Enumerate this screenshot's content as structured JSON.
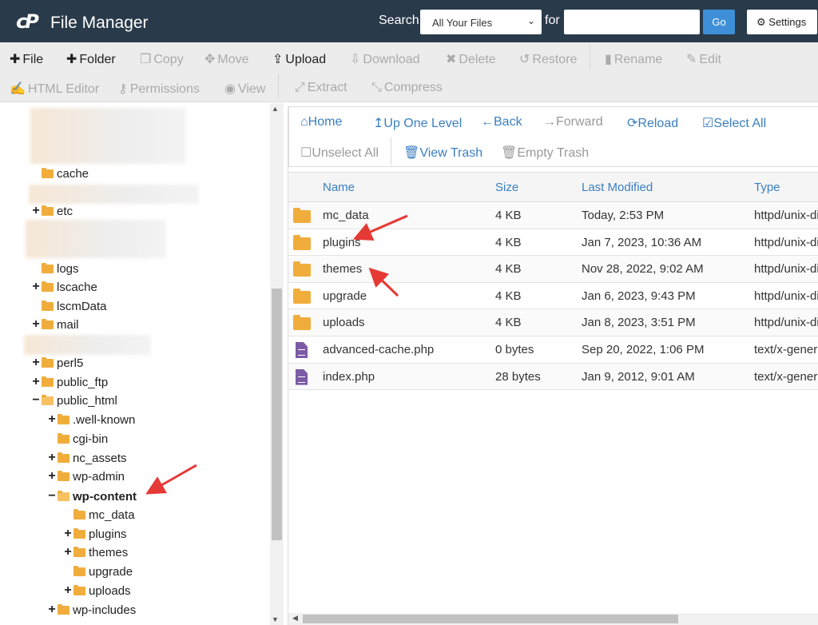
{
  "header": {
    "title": "File Manager",
    "search_label": "Search",
    "search_scope": "All Your Files",
    "for_label": "for",
    "search_value": "",
    "go": "Go",
    "settings": "Settings"
  },
  "toolbar": [
    {
      "label": "File",
      "icon": "plus",
      "enabled": true
    },
    {
      "label": "Folder",
      "icon": "plus",
      "enabled": true
    },
    {
      "label": "Copy",
      "icon": "copy",
      "enabled": false
    },
    {
      "label": "Move",
      "icon": "move",
      "enabled": false
    },
    {
      "label": "Upload",
      "icon": "upload",
      "enabled": true
    },
    {
      "label": "Download",
      "icon": "download",
      "enabled": false
    },
    {
      "label": "Delete",
      "icon": "x",
      "enabled": false
    },
    {
      "label": "Restore",
      "icon": "undo",
      "enabled": false
    },
    {
      "label": "Rename",
      "icon": "file",
      "enabled": false
    },
    {
      "label": "Edit",
      "icon": "pencil",
      "enabled": false
    },
    {
      "label": "HTML Editor",
      "icon": "edit",
      "enabled": false
    },
    {
      "label": "Permissions",
      "icon": "key",
      "enabled": false
    },
    {
      "label": "View",
      "icon": "eye",
      "enabled": false
    },
    {
      "label": "Extract",
      "icon": "expand",
      "enabled": false
    },
    {
      "label": "Compress",
      "icon": "compress",
      "enabled": false
    }
  ],
  "nav": [
    {
      "label": "Home",
      "icon": "home"
    },
    {
      "label": "Up One Level",
      "icon": "level-up"
    },
    {
      "label": "Back",
      "icon": "arrow-left"
    },
    {
      "label": "Forward",
      "icon": "arrow-right"
    },
    {
      "label": "Reload",
      "icon": "refresh"
    },
    {
      "label": "Select All",
      "icon": "check-square"
    },
    {
      "label": "Unselect All",
      "icon": "square"
    },
    {
      "label": "View Trash",
      "icon": "trash"
    },
    {
      "label": "Empty Trash",
      "icon": "trash"
    }
  ],
  "tree": [
    {
      "label": "cache",
      "exp": ""
    },
    {
      "label": "etc",
      "exp": "+"
    },
    {
      "label": "logs",
      "exp": ""
    },
    {
      "label": "lscache",
      "exp": "+"
    },
    {
      "label": "lscmData",
      "exp": ""
    },
    {
      "label": "mail",
      "exp": "+"
    },
    {
      "label": "perl5",
      "exp": "+"
    },
    {
      "label": "public_ftp",
      "exp": "+"
    },
    {
      "label": "public_html",
      "exp": "−"
    },
    {
      "label": ".well-known",
      "exp": "+"
    },
    {
      "label": "cgi-bin",
      "exp": ""
    },
    {
      "label": "nc_assets",
      "exp": "+"
    },
    {
      "label": "wp-admin",
      "exp": "+"
    },
    {
      "label": "wp-content",
      "exp": "−"
    },
    {
      "label": "mc_data",
      "exp": ""
    },
    {
      "label": "plugins",
      "exp": "+"
    },
    {
      "label": "themes",
      "exp": "+"
    },
    {
      "label": "upgrade",
      "exp": ""
    },
    {
      "label": "uploads",
      "exp": "+"
    },
    {
      "label": "wp-includes",
      "exp": "+"
    }
  ],
  "table": {
    "headers": [
      "Name",
      "Size",
      "Last Modified",
      "Type"
    ],
    "rows": [
      {
        "kind": "folder",
        "name": "mc_data",
        "size": "4 KB",
        "modified": "Today, 2:53 PM",
        "type": "httpd/unix-di"
      },
      {
        "kind": "folder",
        "name": "plugins",
        "size": "4 KB",
        "modified": "Jan 7, 2023, 10:36 AM",
        "type": "httpd/unix-di"
      },
      {
        "kind": "folder",
        "name": "themes",
        "size": "4 KB",
        "modified": "Nov 28, 2022, 9:02 AM",
        "type": "httpd/unix-di"
      },
      {
        "kind": "folder",
        "name": "upgrade",
        "size": "4 KB",
        "modified": "Jan 6, 2023, 9:43 PM",
        "type": "httpd/unix-di"
      },
      {
        "kind": "folder",
        "name": "uploads",
        "size": "4 KB",
        "modified": "Jan 8, 2023, 3:51 PM",
        "type": "httpd/unix-di"
      },
      {
        "kind": "file",
        "name": "advanced-cache.php",
        "size": "0 bytes",
        "modified": "Sep 20, 2022, 1:06 PM",
        "type": "text/x-gener"
      },
      {
        "kind": "file",
        "name": "index.php",
        "size": "28 bytes",
        "modified": "Jan 9, 2012, 9:01 AM",
        "type": "text/x-gener"
      }
    ]
  },
  "colors": {
    "header": "#293a4a",
    "link": "#3a7fc1",
    "folder": "#f0ad3c",
    "annotation": "#e53935"
  }
}
